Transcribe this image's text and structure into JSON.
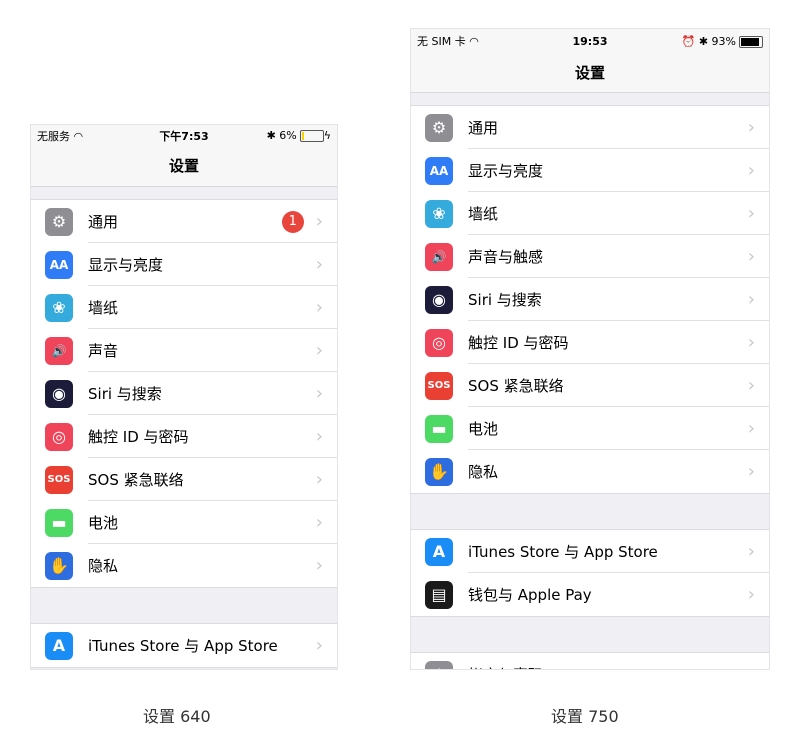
{
  "screens": [
    {
      "id": "p640",
      "status": {
        "carrier": "无服务",
        "time": "下午7:53",
        "right_icons": [
          "bluetooth-icon"
        ],
        "battery": "6%",
        "battery_level": 6,
        "battery_color": "#f5d300",
        "charging": true
      },
      "title": "设置",
      "groups": [
        [
          {
            "label": "通用",
            "icon": "gear-icon",
            "color": "#8e8e93",
            "glyph": "⚙",
            "badge": "1"
          },
          {
            "label": "显示与亮度",
            "icon": "display-icon",
            "color": "#2f7cf6",
            "glyph": "AA"
          },
          {
            "label": "墙纸",
            "icon": "wallpaper-icon",
            "color": "#35aadc",
            "glyph": "❀"
          },
          {
            "label": "声音",
            "icon": "sound-icon",
            "color": "#f0445a",
            "glyph": "🔊"
          },
          {
            "label": "Siri 与搜索",
            "icon": "siri-icon",
            "color": "#1c1c3a",
            "glyph": "◉"
          },
          {
            "label": "触控 ID 与密码",
            "icon": "fingerprint-icon",
            "color": "#f0445a",
            "glyph": "◎"
          },
          {
            "label": "SOS 紧急联络",
            "icon": "sos-icon",
            "color": "#e94033",
            "glyph": "SOS"
          },
          {
            "label": "电池",
            "icon": "battery-icon",
            "color": "#4cd964",
            "glyph": "▬"
          },
          {
            "label": "隐私",
            "icon": "privacy-hand-icon",
            "color": "#2e6de0",
            "glyph": "✋"
          }
        ],
        [
          {
            "label": "iTunes Store 与 App Store",
            "icon": "app-store-icon",
            "color": "#1a8cf5",
            "glyph": "A"
          }
        ]
      ],
      "caption": "设置  640"
    },
    {
      "id": "p750",
      "status": {
        "carrier": "无 SIM 卡",
        "time": "19:53",
        "right_icons": [
          "alarm-icon",
          "bluetooth-icon"
        ],
        "battery": "93%",
        "battery_level": 93,
        "battery_color": "#000000",
        "charging": false
      },
      "title": "设置",
      "groups": [
        [
          {
            "label": "通用",
            "icon": "gear-icon",
            "color": "#8e8e93",
            "glyph": "⚙"
          },
          {
            "label": "显示与亮度",
            "icon": "display-icon",
            "color": "#2f7cf6",
            "glyph": "AA"
          },
          {
            "label": "墙纸",
            "icon": "wallpaper-icon",
            "color": "#35aadc",
            "glyph": "❀"
          },
          {
            "label": "声音与触感",
            "icon": "sound-icon",
            "color": "#f0445a",
            "glyph": "🔊"
          },
          {
            "label": "Siri 与搜索",
            "icon": "siri-icon",
            "color": "#1c1c3a",
            "glyph": "◉"
          },
          {
            "label": "触控 ID 与密码",
            "icon": "fingerprint-icon",
            "color": "#f0445a",
            "glyph": "◎"
          },
          {
            "label": "SOS 紧急联络",
            "icon": "sos-icon",
            "color": "#e94033",
            "glyph": "SOS"
          },
          {
            "label": "电池",
            "icon": "battery-icon",
            "color": "#4cd964",
            "glyph": "▬"
          },
          {
            "label": "隐私",
            "icon": "privacy-hand-icon",
            "color": "#2e6de0",
            "glyph": "✋"
          }
        ],
        [
          {
            "label": "iTunes Store 与 App Store",
            "icon": "app-store-icon",
            "color": "#1a8cf5",
            "glyph": "A"
          },
          {
            "label": "钱包与 Apple Pay",
            "icon": "wallet-icon",
            "color": "#1a1a1a",
            "glyph": "▤"
          }
        ],
        [
          {
            "label": "帐户与密码",
            "icon": "key-icon",
            "color": "#8e8e93",
            "glyph": "⚷"
          }
        ]
      ],
      "caption": "设置  750"
    }
  ]
}
